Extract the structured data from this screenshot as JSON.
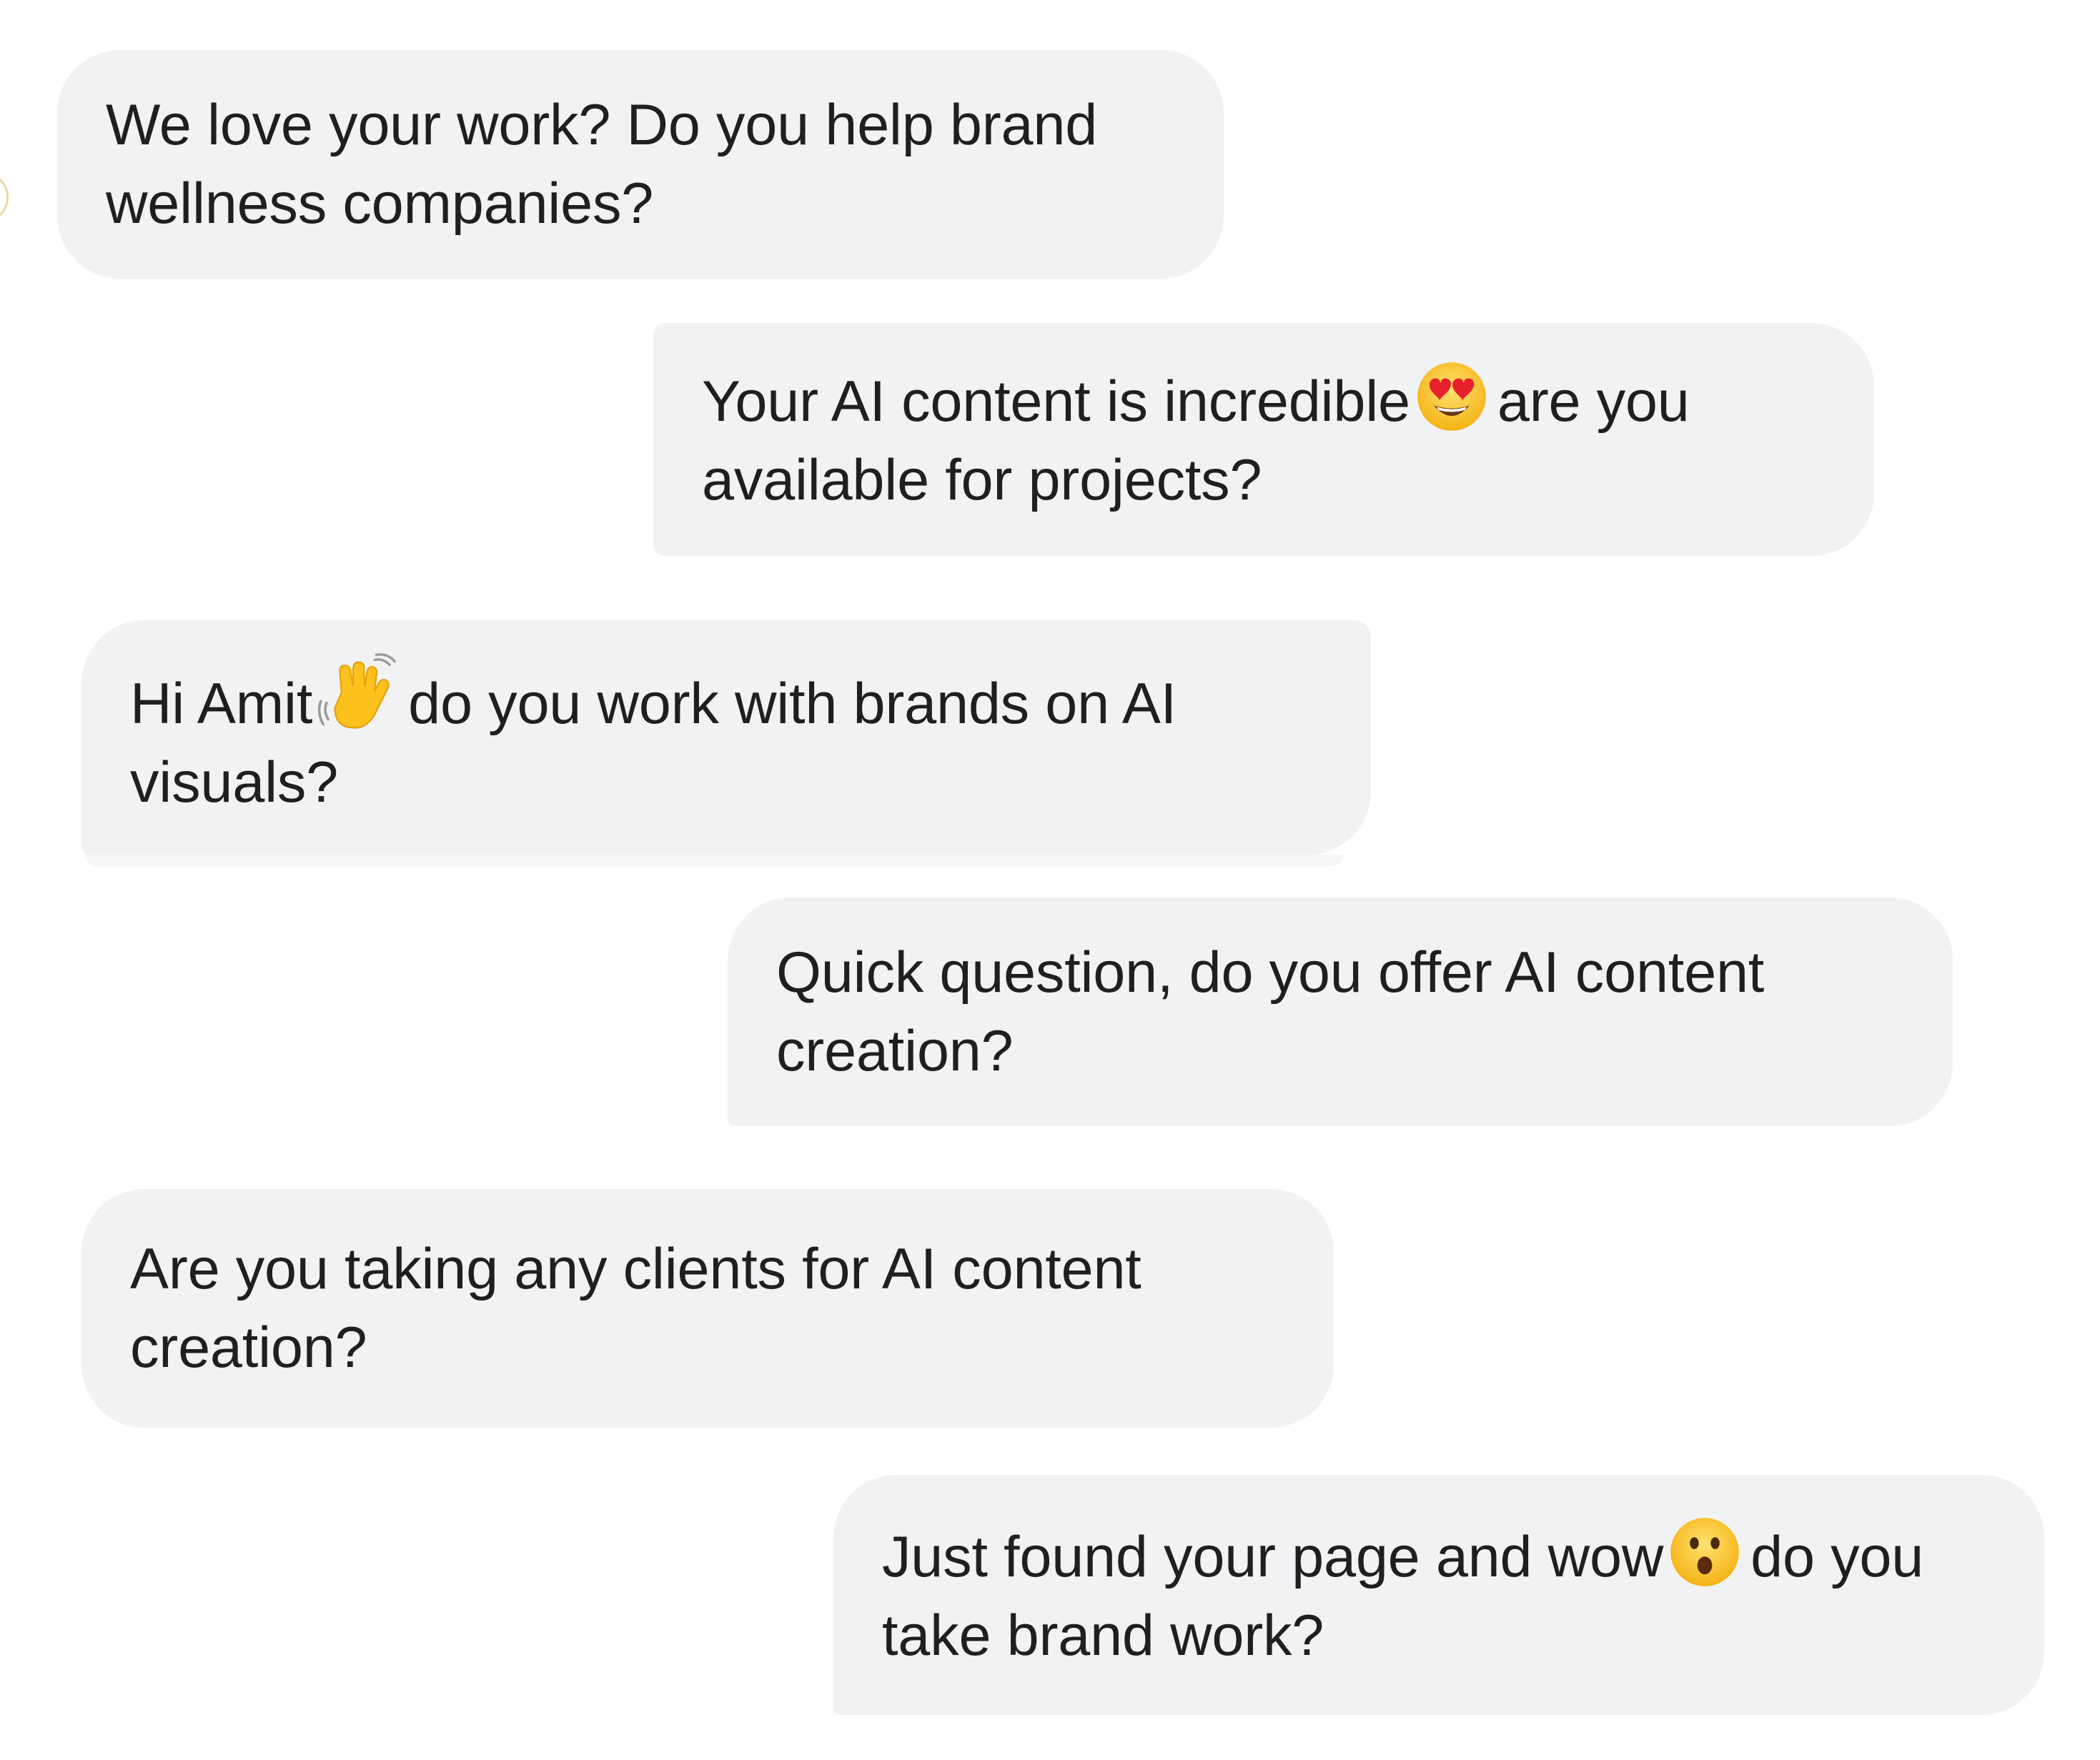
{
  "conversation": {
    "messages": [
      {
        "direction": "received",
        "text": "We love your work? Do you help brand wellness companies?"
      },
      {
        "direction": "sent",
        "text_before": "Your AI content is incredible",
        "emoji": "smiling-face-with-heart-eyes",
        "text_after": "are you available for projects?"
      },
      {
        "direction": "received",
        "text_before": "Hi Amit",
        "emoji": "waving-hand",
        "text_after": "do you work with brands on AI visuals?"
      },
      {
        "direction": "sent",
        "text": "Quick question, do you offer AI content creation?"
      },
      {
        "direction": "received",
        "text": "Are you taking any clients for AI content creation?"
      },
      {
        "direction": "sent",
        "text_before": "Just found your page and wow",
        "emoji": "face-with-open-mouth",
        "text_after": "do you take brand work?"
      }
    ]
  },
  "colors": {
    "bubble_background": "#f1f2f4",
    "text": "#1f1f1f",
    "page_background": "#ffffff"
  }
}
